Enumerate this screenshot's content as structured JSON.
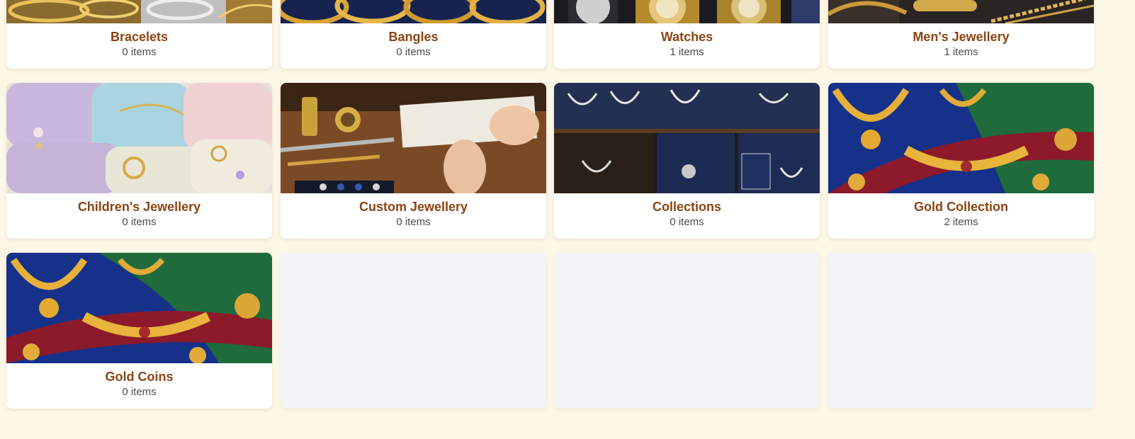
{
  "categories": [
    {
      "name": "Bracelets",
      "count": "0 items",
      "image": "bracelets-photo"
    },
    {
      "name": "Bangles",
      "count": "0 items",
      "image": "bangles-photo"
    },
    {
      "name": "Watches",
      "count": "1 items",
      "image": "watches-photo"
    },
    {
      "name": "Men's Jewellery",
      "count": "1 items",
      "image": "mens-jewellery-photo"
    },
    {
      "name": "Children's Jewellery",
      "count": "0 items",
      "image": "childrens-jewellery-photo"
    },
    {
      "name": "Custom Jewellery",
      "count": "0 items",
      "image": "custom-jewellery-photo"
    },
    {
      "name": "Collections",
      "count": "0 items",
      "image": "collections-photo"
    },
    {
      "name": "Gold Collection",
      "count": "2 items",
      "image": "gold-collection-photo"
    },
    {
      "name": "Gold Coins",
      "count": "0 items",
      "image": "gold-coins-photo"
    }
  ],
  "colors": {
    "page_background": "#fdf7e7",
    "title": "#8b4513",
    "count": "#4b4b4b",
    "placeholder": "#f3f4f6"
  }
}
